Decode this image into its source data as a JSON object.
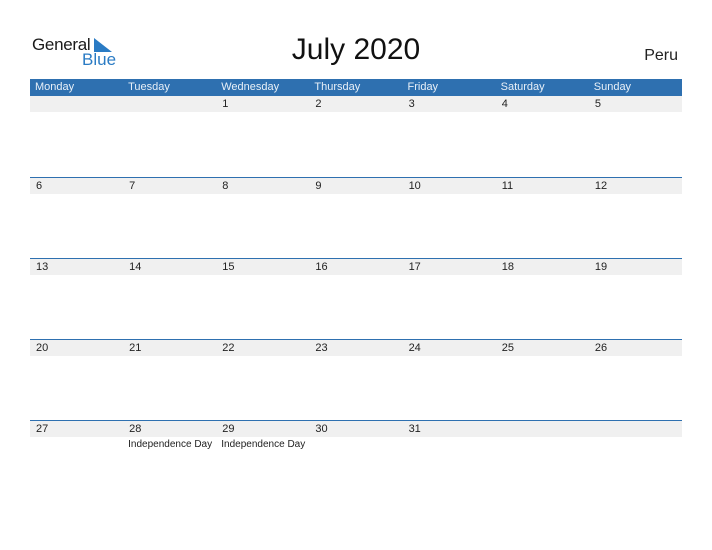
{
  "logo": {
    "general": "General",
    "blue": "Blue",
    "icon": "logo-triangle-icon"
  },
  "title": "July 2020",
  "country": "Peru",
  "colors": {
    "accent": "#2e70b0",
    "strip": "#f0f0f0",
    "logo_blue": "#2a7bc4"
  },
  "weekdays": [
    "Monday",
    "Tuesday",
    "Wednesday",
    "Thursday",
    "Friday",
    "Saturday",
    "Sunday"
  ],
  "weeks": [
    {
      "days": [
        {
          "num": "",
          "holiday": ""
        },
        {
          "num": "",
          "holiday": ""
        },
        {
          "num": "1",
          "holiday": ""
        },
        {
          "num": "2",
          "holiday": ""
        },
        {
          "num": "3",
          "holiday": ""
        },
        {
          "num": "4",
          "holiday": ""
        },
        {
          "num": "5",
          "holiday": ""
        }
      ]
    },
    {
      "days": [
        {
          "num": "6",
          "holiday": ""
        },
        {
          "num": "7",
          "holiday": ""
        },
        {
          "num": "8",
          "holiday": ""
        },
        {
          "num": "9",
          "holiday": ""
        },
        {
          "num": "10",
          "holiday": ""
        },
        {
          "num": "11",
          "holiday": ""
        },
        {
          "num": "12",
          "holiday": ""
        }
      ]
    },
    {
      "days": [
        {
          "num": "13",
          "holiday": ""
        },
        {
          "num": "14",
          "holiday": ""
        },
        {
          "num": "15",
          "holiday": ""
        },
        {
          "num": "16",
          "holiday": ""
        },
        {
          "num": "17",
          "holiday": ""
        },
        {
          "num": "18",
          "holiday": ""
        },
        {
          "num": "19",
          "holiday": ""
        }
      ]
    },
    {
      "days": [
        {
          "num": "20",
          "holiday": ""
        },
        {
          "num": "21",
          "holiday": ""
        },
        {
          "num": "22",
          "holiday": ""
        },
        {
          "num": "23",
          "holiday": ""
        },
        {
          "num": "24",
          "holiday": ""
        },
        {
          "num": "25",
          "holiday": ""
        },
        {
          "num": "26",
          "holiday": ""
        }
      ]
    },
    {
      "days": [
        {
          "num": "27",
          "holiday": ""
        },
        {
          "num": "28",
          "holiday": "Independence Day"
        },
        {
          "num": "29",
          "holiday": "Independence Day"
        },
        {
          "num": "30",
          "holiday": ""
        },
        {
          "num": "31",
          "holiday": ""
        },
        {
          "num": "",
          "holiday": ""
        },
        {
          "num": "",
          "holiday": ""
        }
      ]
    }
  ]
}
